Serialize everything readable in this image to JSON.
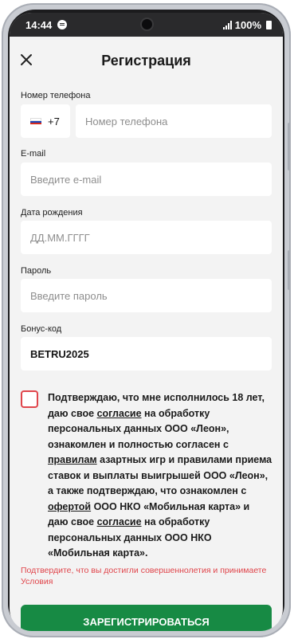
{
  "status_bar": {
    "time": "14:44",
    "battery": "100%"
  },
  "header": {
    "title": "Регистрация"
  },
  "phone": {
    "label": "Номер телефона",
    "country_code": "+7",
    "placeholder": "Номер телефона"
  },
  "email": {
    "label": "E-mail",
    "placeholder": "Введите e-mail"
  },
  "birthdate": {
    "label": "Дата рождения",
    "placeholder": "ДД.ММ.ГГГГ"
  },
  "password": {
    "label": "Пароль",
    "placeholder": "Введите пароль"
  },
  "bonus": {
    "label": "Бонус-код",
    "value": "BETRU2025"
  },
  "consent": {
    "t1": "Подтверждаю, что мне исполнилось 18 лет, даю свое ",
    "link1": "согласие",
    "t2": " на обработку персональных данных ООО «Леон», ознакомлен и полностью согласен с ",
    "link2": "правилам",
    "t3": " азартных игр и правилами приема ставок и выплаты выигрышей ООО «Леон», а также подтверждаю, что ознакомлен с ",
    "link3": "офертой",
    "t4": " ООО НКО «Мобильная карта» и даю свое ",
    "link4": "согласие",
    "t5": " на обработку персональных данных ООО НКО «Мобильная карта»."
  },
  "error_text": "Подтвердите, что вы достигли совершеннолетия и принимаете Условия",
  "submit_label": "ЗАРЕГИСТРИРОВАТЬСЯ",
  "colors": {
    "accent": "#178a44",
    "error": "#e0454b",
    "background": "#f3f3f3"
  }
}
